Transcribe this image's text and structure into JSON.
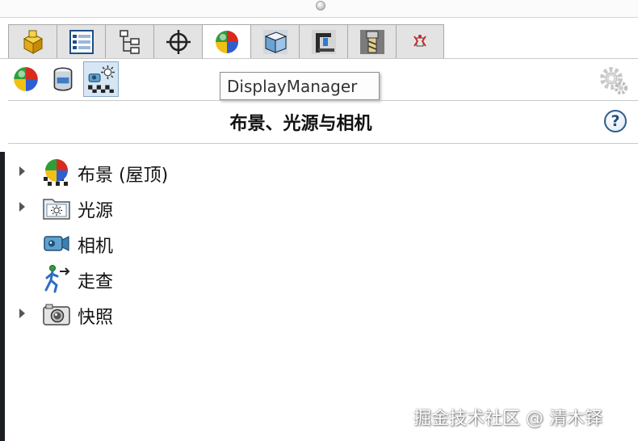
{
  "tooltip": {
    "text": "DisplayManager"
  },
  "panel": {
    "title": "布景、光源与相机",
    "help_glyph": "?"
  },
  "tabs": [
    {
      "name": "tab-feature-manager",
      "icon": "part-cube-icon"
    },
    {
      "name": "tab-property-manager",
      "icon": "property-list-icon"
    },
    {
      "name": "tab-configuration-manager",
      "icon": "configuration-tree-icon"
    },
    {
      "name": "tab-dimxpert-manager",
      "icon": "crosshair-icon"
    },
    {
      "name": "tab-display-manager",
      "icon": "appearance-ball-icon",
      "active": true
    },
    {
      "name": "tab-cam-feature",
      "icon": "cam-feature-icon"
    },
    {
      "name": "tab-cam-operation",
      "icon": "cam-operation-icon"
    },
    {
      "name": "tab-cam-tool",
      "icon": "cam-tool-icon"
    },
    {
      "name": "tab-cam-toolpath",
      "icon": "toolpath-icon"
    }
  ],
  "toolbar": [
    {
      "name": "appearances-view-button",
      "icon": "appearance-ball-icon"
    },
    {
      "name": "decals-view-button",
      "icon": "decal-cylinder-icon"
    },
    {
      "name": "scene-lights-cameras-button",
      "icon": "scene-lights-camera-icon",
      "pressed": true
    }
  ],
  "tree": [
    {
      "label": "布景 (屋顶)",
      "icon": "scene-icon",
      "expandable": true
    },
    {
      "label": "光源",
      "icon": "light-folder-icon",
      "expandable": true
    },
    {
      "label": "相机",
      "icon": "camera-icon",
      "expandable": false
    },
    {
      "label": "走查",
      "icon": "walkthrough-icon",
      "expandable": false
    },
    {
      "label": "快照",
      "icon": "snapshot-icon",
      "expandable": true
    }
  ],
  "watermark": {
    "text": "掘金技术社区 @ 清木铎"
  },
  "colors": {
    "accent": "#2e5d8e",
    "tab_bg": "#e3e3e3",
    "pressed_bg": "#d7e6f5"
  }
}
